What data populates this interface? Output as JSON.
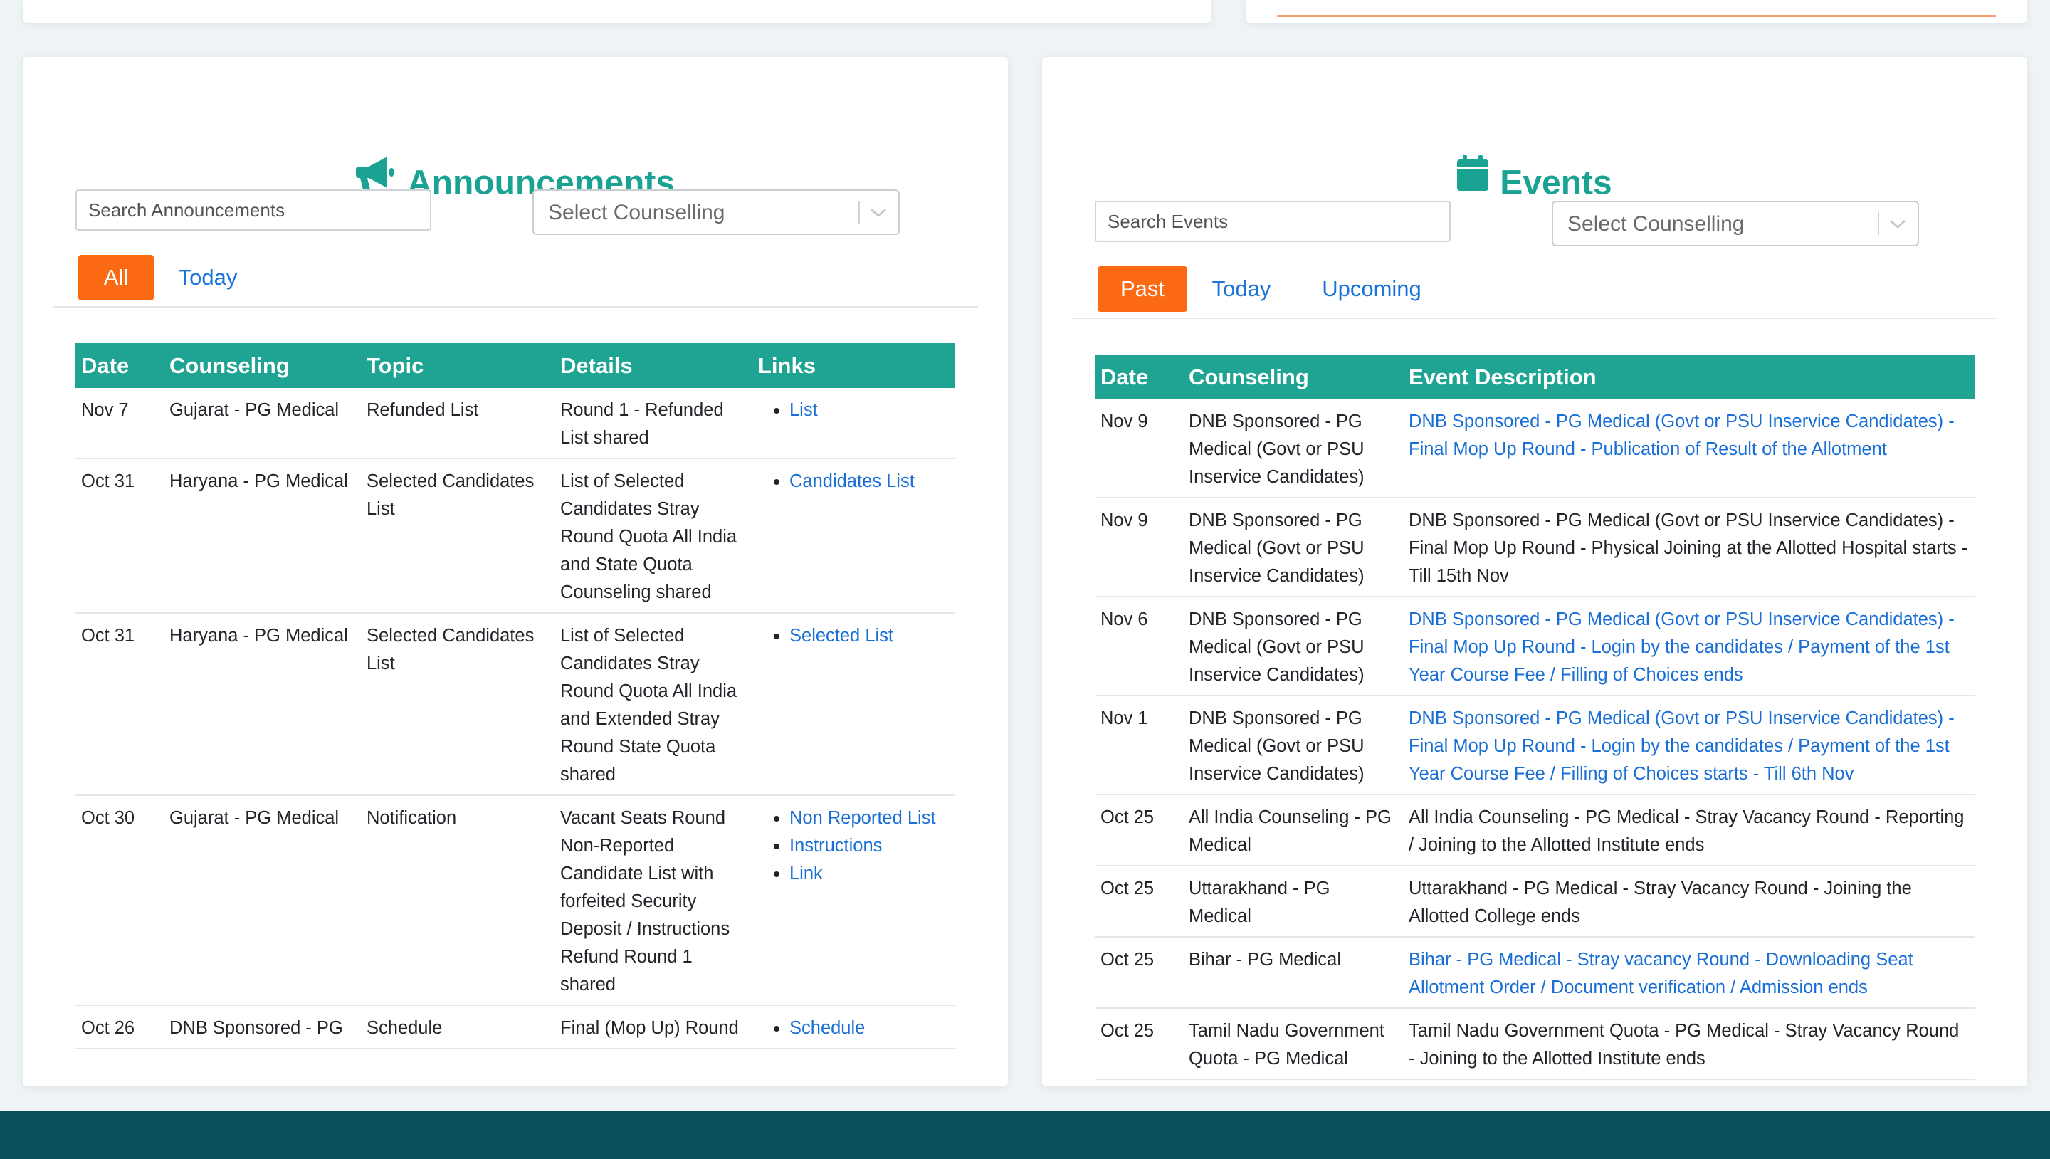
{
  "colors": {
    "accent_teal": "#1fa393",
    "accent_orange": "#fb6a12",
    "link_blue": "#1a6fd6",
    "footer": "#0a4d5c"
  },
  "announcements": {
    "title": "Announcements",
    "icon": "megaphone-icon",
    "search_placeholder": "Search Announcements",
    "select_placeholder": "Select Counselling",
    "filters": [
      "All",
      "Today"
    ],
    "active_filter": "All",
    "columns": [
      "Date",
      "Counseling",
      "Topic",
      "Details",
      "Links"
    ],
    "rows": [
      {
        "date": "Nov 7",
        "counseling": "Gujarat - PG Medical",
        "topic": "Refunded List",
        "details": "Round 1 - Refunded List shared",
        "links": [
          "List"
        ]
      },
      {
        "date": "Oct 31",
        "counseling": "Haryana - PG Medical",
        "topic": "Selected Candidates List",
        "details": "List of Selected Candidates Stray Round Quota All India and State Quota Counseling shared",
        "links": [
          "Candidates List"
        ]
      },
      {
        "date": "Oct 31",
        "counseling": "Haryana - PG Medical",
        "topic": "Selected Candidates List",
        "details": "List of Selected Candidates Stray Round Quota All India and Extended Stray Round State Quota shared",
        "links": [
          "Selected List"
        ]
      },
      {
        "date": "Oct 30",
        "counseling": "Gujarat - PG Medical",
        "topic": "Notification",
        "details": "Vacant Seats Round Non-Reported Candidate List with forfeited Security Deposit / Instructions Refund Round 1 shared",
        "links": [
          "Non Reported List",
          "Instructions",
          "Link"
        ]
      },
      {
        "date": "Oct 26",
        "counseling": "DNB Sponsored - PG",
        "topic": "Schedule",
        "details": "Final (Mop Up) Round",
        "links": [
          "Schedule"
        ]
      }
    ]
  },
  "events": {
    "title": "Events",
    "icon": "calendar-icon",
    "search_placeholder": "Search Events",
    "select_placeholder": "Select Counselling",
    "filters": [
      "Past",
      "Today",
      "Upcoming"
    ],
    "active_filter": "Past",
    "columns": [
      "Date",
      "Counseling",
      "Event Description"
    ],
    "rows": [
      {
        "date": "Nov 9",
        "counseling": "DNB Sponsored - PG Medical (Govt or PSU Inservice Candidates)",
        "description": "DNB Sponsored - PG Medical (Govt or PSU Inservice Candidates) - Final Mop Up Round - Publication of Result of the Allotment",
        "is_link": true
      },
      {
        "date": "Nov 9",
        "counseling": "DNB Sponsored - PG Medical (Govt or PSU Inservice Candidates)",
        "description": "DNB Sponsored - PG Medical (Govt or PSU Inservice Candidates) - Final Mop Up Round - Physical Joining at the Allotted Hospital starts - Till 15th Nov",
        "is_link": false
      },
      {
        "date": "Nov 6",
        "counseling": "DNB Sponsored - PG Medical (Govt or PSU Inservice Candidates)",
        "description": "DNB Sponsored - PG Medical (Govt or PSU Inservice Candidates) - Final Mop Up Round - Login by the candidates / Payment of the 1st Year Course Fee / Filling of Choices ends",
        "is_link": true
      },
      {
        "date": "Nov 1",
        "counseling": "DNB Sponsored - PG Medical (Govt or PSU Inservice Candidates)",
        "description": "DNB Sponsored - PG Medical (Govt or PSU Inservice Candidates) - Final Mop Up Round - Login by the candidates / Payment of the 1st Year Course Fee / Filling of Choices starts - Till 6th Nov",
        "is_link": true
      },
      {
        "date": "Oct 25",
        "counseling": "All India Counseling - PG Medical",
        "description": "All India Counseling - PG Medical - Stray Vacancy Round - Reporting / Joining to the Allotted Institute ends",
        "is_link": false
      },
      {
        "date": "Oct 25",
        "counseling": "Uttarakhand - PG Medical",
        "description": "Uttarakhand - PG Medical - Stray Vacancy Round - Joining the Allotted College ends",
        "is_link": false
      },
      {
        "date": "Oct 25",
        "counseling": "Bihar - PG Medical",
        "description": "Bihar - PG Medical - Stray vacancy Round - Downloading Seat Allotment Order / Document verification / Admission ends",
        "is_link": true
      },
      {
        "date": "Oct 25",
        "counseling": "Tamil Nadu Government Quota - PG Medical",
        "description": "Tamil Nadu Government Quota - PG Medical - Stray Vacancy Round - Joining to the Allotted Institute ends",
        "is_link": false
      }
    ]
  }
}
